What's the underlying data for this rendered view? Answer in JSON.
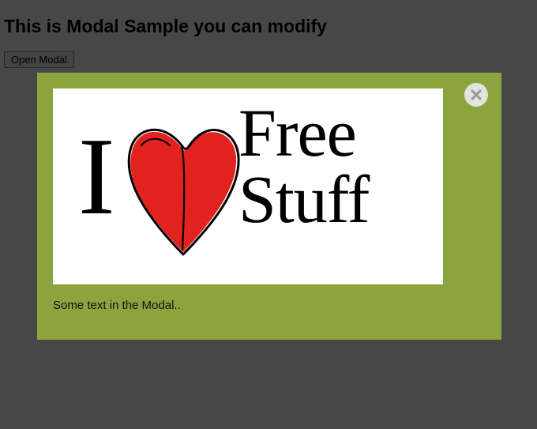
{
  "heading": "This is Modal Sample you can modify",
  "open_button": "Open Modal",
  "modal": {
    "text": "Some text in the Modal..",
    "hero": {
      "letter": "I",
      "line1": "Free",
      "line2": "Stuff"
    }
  }
}
